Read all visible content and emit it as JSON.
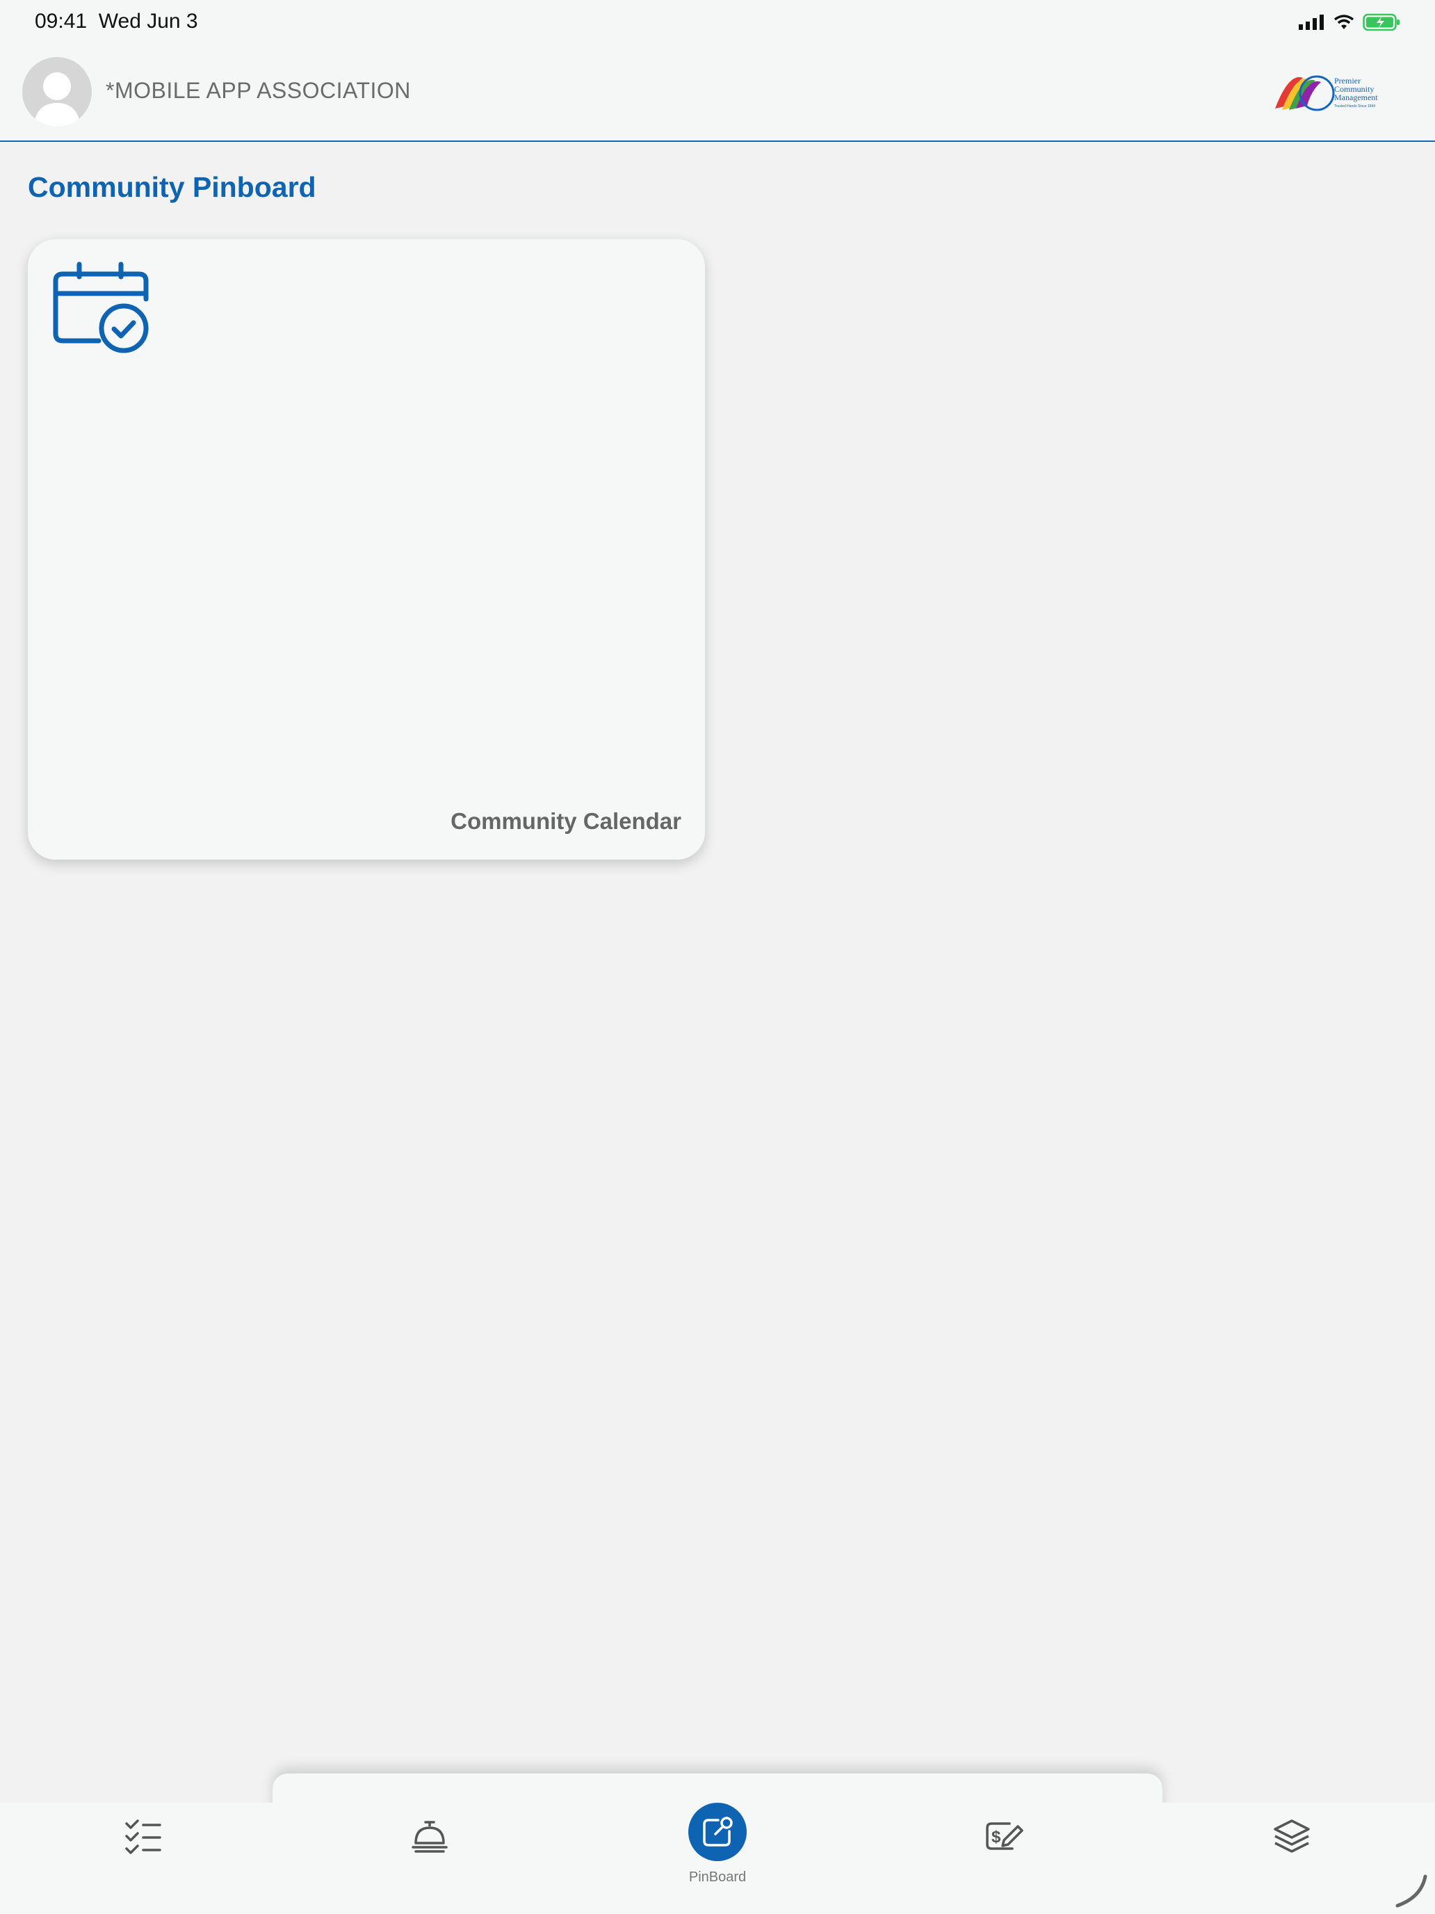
{
  "status_bar": {
    "time": "09:41",
    "date": "Wed Jun 3"
  },
  "header": {
    "association_name": "*MOBILE APP ASSOCIATION",
    "logo_text": [
      "Premier",
      "Community",
      "Management",
      "Trusted Hands Since 1994"
    ]
  },
  "page": {
    "title": "Community Pinboard"
  },
  "cards": [
    {
      "label": "Community Calendar",
      "icon": "calendar-check-icon"
    }
  ],
  "tabs": [
    {
      "id": "tasks",
      "icon": "checklist-icon",
      "label": ""
    },
    {
      "id": "services",
      "icon": "service-bell-icon",
      "label": ""
    },
    {
      "id": "pinboard",
      "icon": "pinboard-icon",
      "label": "PinBoard",
      "active": true
    },
    {
      "id": "payments",
      "icon": "payment-icon",
      "label": ""
    },
    {
      "id": "layers",
      "icon": "layers-icon",
      "label": ""
    }
  ],
  "colors": {
    "accent": "#0e63b3",
    "battery": "#34c759"
  }
}
